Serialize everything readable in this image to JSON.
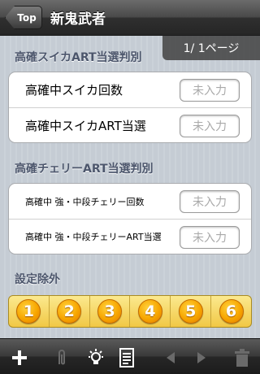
{
  "nav": {
    "back_label": "Top",
    "title": "新鬼武者"
  },
  "page_indicator": "1/ 1ページ",
  "sections": [
    {
      "header": "高確スイカART当選判別",
      "rows": [
        {
          "label": "高確中スイカ回数",
          "placeholder": "未入力"
        },
        {
          "label": "高確中スイカART当選",
          "placeholder": "未入力"
        }
      ]
    },
    {
      "header": "高確チェリーART当選判別",
      "rows": [
        {
          "label": "高確中 強・中段チェリー回数",
          "placeholder": "未入力"
        },
        {
          "label": "高確中 強・中段チェリーART当選",
          "placeholder": "未入力"
        }
      ]
    },
    {
      "header": "設定除外"
    }
  ],
  "settings_buttons": [
    "1",
    "2",
    "3",
    "4",
    "5",
    "6"
  ],
  "toolbar": {
    "items": [
      "add-icon",
      "clip-icon",
      "lightbulb-icon",
      "document-icon",
      "back-arrow-icon",
      "forward-arrow-icon",
      "trash-icon"
    ]
  },
  "colors": {
    "section_header": "#4c566c",
    "coin_orange": "#f7a600",
    "strip_yellow": "#f1c845"
  }
}
